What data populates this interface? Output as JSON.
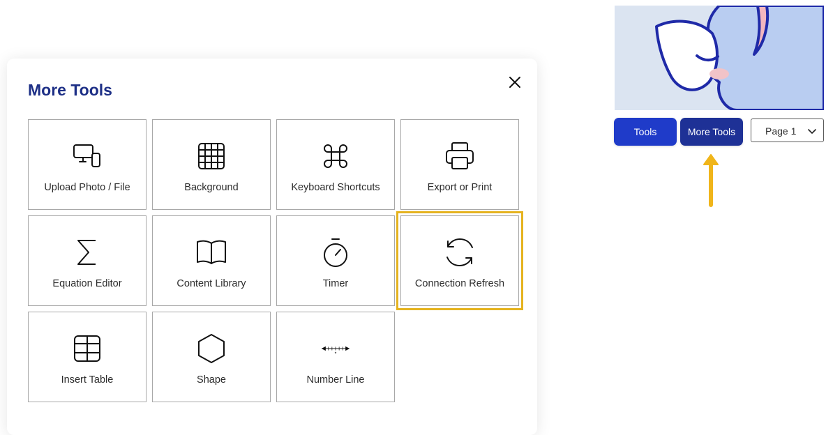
{
  "modal": {
    "title": "More Tools",
    "tiles": [
      {
        "label": "Upload Photo / File",
        "icon": "upload-device-icon"
      },
      {
        "label": "Background",
        "icon": "grid-icon"
      },
      {
        "label": "Keyboard Shortcuts",
        "icon": "command-key-icon"
      },
      {
        "label": "Export or Print",
        "icon": "printer-icon"
      },
      {
        "label": "Equation Editor",
        "icon": "sigma-icon"
      },
      {
        "label": "Content Library",
        "icon": "open-book-icon"
      },
      {
        "label": "Timer",
        "icon": "stopwatch-icon"
      },
      {
        "label": "Connection Refresh",
        "icon": "refresh-icon"
      },
      {
        "label": "Insert Table",
        "icon": "table-icon"
      },
      {
        "label": "Shape",
        "icon": "hexagon-icon"
      },
      {
        "label": "Number Line",
        "icon": "number-line-icon"
      }
    ],
    "highlight_color": "#e5b320"
  },
  "toolbar": {
    "tools_label": "Tools",
    "more_tools_label": "More Tools",
    "page_select_value": "Page 1"
  },
  "colors": {
    "title": "#1d2f86",
    "tools_button": "#1f3bc9",
    "more_tools_button": "#1e3196",
    "arrow": "#f0b51a"
  }
}
